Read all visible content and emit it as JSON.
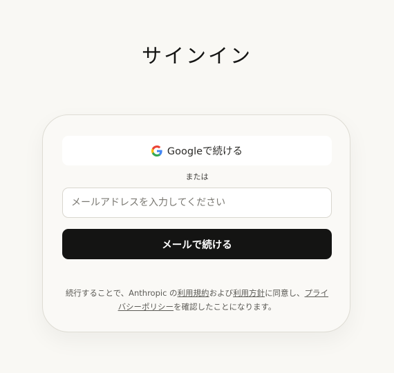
{
  "header": {
    "title": "サインイン"
  },
  "signin": {
    "google_button_label": "Googleで続ける",
    "google_icon": "google-logo-icon",
    "divider_text": "または",
    "email_placeholder": "メールアドレスを入力してください",
    "email_value": "",
    "continue_label": "メールで続ける"
  },
  "legal": {
    "prefix": "続行することで、Anthropic の",
    "terms_link": "利用規約",
    "and_text": "および",
    "policy_link": "利用方針",
    "middle": "に同意し、",
    "privacy_link": "プライバシーポリシー",
    "suffix": "を確認したことになります。"
  },
  "colors": {
    "background": "#f9f8f4",
    "primary_button": "#141413",
    "card_border": "#dedcd4"
  }
}
